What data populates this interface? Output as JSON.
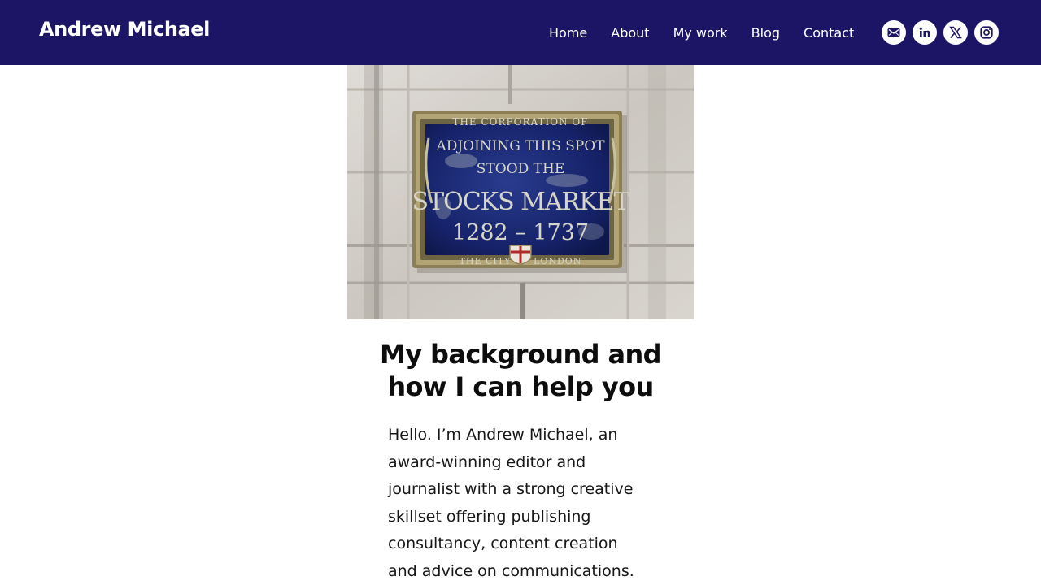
{
  "header": {
    "site_title": "Andrew Michael",
    "nav": [
      {
        "label": "Home"
      },
      {
        "label": "About"
      },
      {
        "label": "My work"
      },
      {
        "label": "Blog"
      },
      {
        "label": "Contact"
      }
    ],
    "social": [
      {
        "icon": "email-icon"
      },
      {
        "icon": "linkedin-icon"
      },
      {
        "icon": "x-icon"
      },
      {
        "icon": "instagram-icon"
      }
    ],
    "colors": {
      "header_bg": "#1c1464",
      "text": "#ffffff"
    }
  },
  "hero_image": {
    "plaque_lines": [
      "THE CORPORATION OF",
      "ADJOINING THIS SPOT",
      "STOOD THE",
      "STOCKS MARKET",
      "1282 – 1737",
      "THE CITY OF LONDON"
    ]
  },
  "main": {
    "heading_line1": "My background and",
    "heading_line2": "how I can help you",
    "intro_lines": [
      "Hello. I’m Andrew Michael, an",
      "award-winning editor and",
      "journalist with a strong creative",
      "skillset offering publishing",
      "consultancy, content creation",
      "and advice on communications."
    ]
  }
}
